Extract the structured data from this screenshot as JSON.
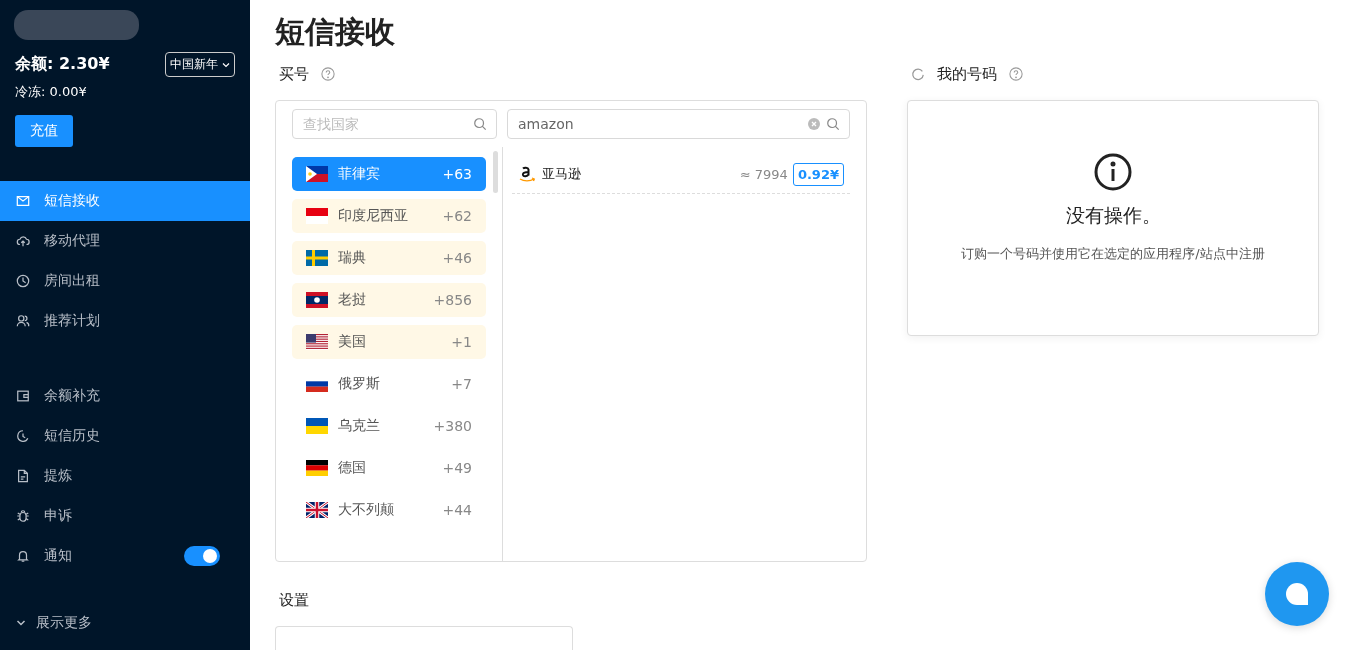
{
  "sidebar": {
    "balance": "余额: 2.30¥",
    "frozen": "冷冻: 0.00¥",
    "promo_select": "中国新年",
    "topup_button": "充值",
    "menu": [
      {
        "label": "短信接收",
        "selected": true
      },
      {
        "label": "移动代理",
        "selected": false
      },
      {
        "label": "房间出租",
        "selected": false
      },
      {
        "label": "推荐计划",
        "selected": false
      }
    ],
    "menu2": [
      {
        "label": "余额补充",
        "selected": false
      },
      {
        "label": "短信历史",
        "selected": false
      },
      {
        "label": "提炼",
        "selected": false
      },
      {
        "label": "申诉",
        "selected": false
      },
      {
        "label": "通知",
        "selected": false,
        "toggle": true
      }
    ],
    "show_more": "展示更多"
  },
  "page_title": "短信接收",
  "buy": {
    "label": "买号",
    "country_search": {
      "placeholder": "查找国家"
    },
    "service_search": {
      "value": "amazon"
    },
    "countries": [
      {
        "name": "菲律宾",
        "code": "+63",
        "kind": "ph",
        "selected": true
      },
      {
        "name": "印度尼西亚",
        "code": "+62",
        "kind": "id",
        "selected": false,
        "pinned": true
      },
      {
        "name": "瑞典",
        "code": "+46",
        "kind": "se",
        "selected": false,
        "pinned": true
      },
      {
        "name": "老挝",
        "code": "+856",
        "kind": "la",
        "selected": false,
        "pinned": true
      },
      {
        "name": "美国",
        "code": "+1",
        "kind": "us",
        "selected": false,
        "pinned": true
      },
      {
        "name": "俄罗斯",
        "code": "+7",
        "kind": "ru",
        "selected": false,
        "pinned": false
      },
      {
        "name": "乌克兰",
        "code": "+380",
        "kind": "ua",
        "selected": false,
        "pinned": false
      },
      {
        "name": "德国",
        "code": "+49",
        "kind": "de",
        "selected": false,
        "pinned": false
      },
      {
        "name": "大不列颠",
        "code": "+44",
        "kind": "gb",
        "selected": false,
        "pinned": false
      }
    ],
    "services": [
      {
        "name": "亚马逊",
        "count": "≈ 7994",
        "price": "0.92¥"
      }
    ]
  },
  "my_numbers": {
    "label": "我的号码",
    "empty_title": "没有操作。",
    "empty_text": "订购一个号码并使用它在选定的应用程序/站点中注册"
  },
  "settings": {
    "label": "设置"
  }
}
